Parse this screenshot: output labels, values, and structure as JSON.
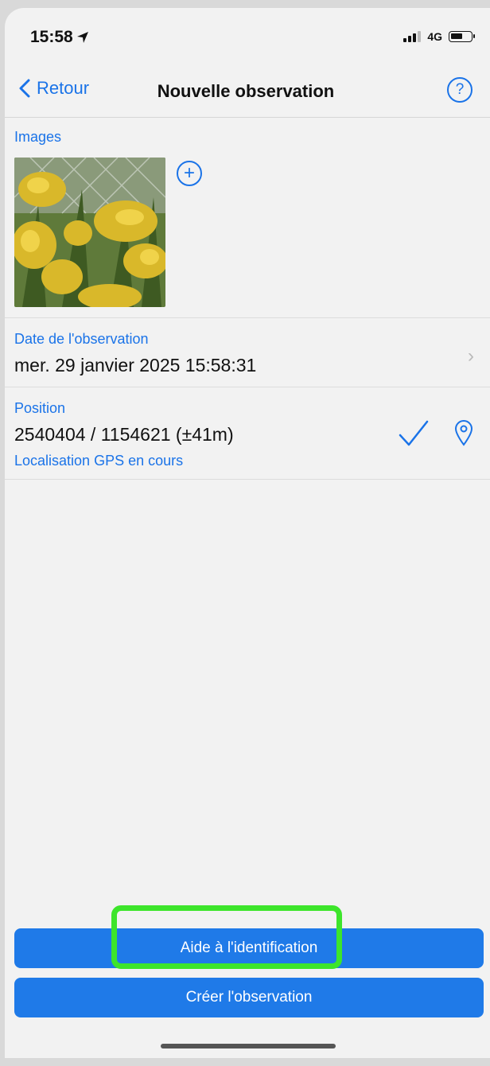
{
  "status_bar": {
    "time": "15:58",
    "network": "4G",
    "battery_level": 0.6
  },
  "nav": {
    "back_label": "Retour",
    "title": "Nouvelle observation",
    "help_label": "?"
  },
  "images": {
    "label": "Images",
    "add_label": "+"
  },
  "date": {
    "label": "Date de l'observation",
    "value": "mer. 29 janvier 2025 15:58:31"
  },
  "position": {
    "label": "Position",
    "value": "2540404 / 1154621 (±41m)",
    "status": "Localisation GPS en cours"
  },
  "buttons": {
    "identify_label": "Aide à l'identification",
    "create_label": "Créer l'observation"
  },
  "colors": {
    "accent": "#1a73e8",
    "button": "#1f7ae8",
    "highlight": "#3de52b"
  }
}
